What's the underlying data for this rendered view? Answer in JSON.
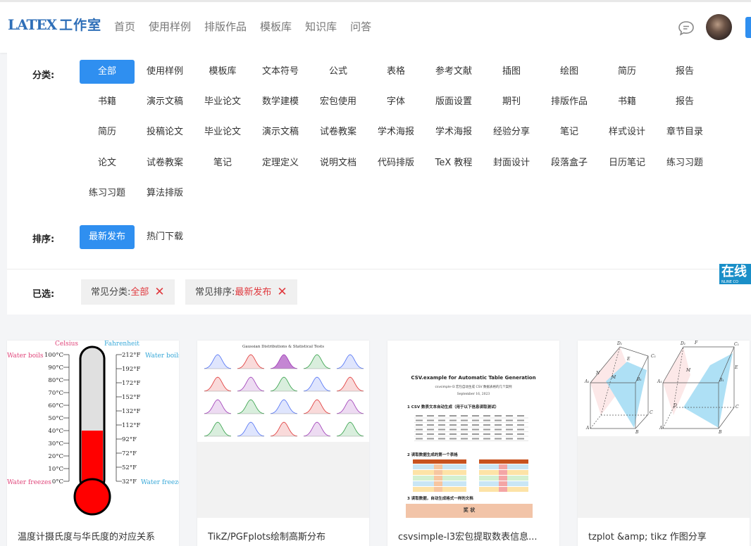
{
  "header": {
    "logo_latex": "LATEX",
    "logo_cn": "工作室",
    "nav": [
      "首页",
      "使用样例",
      "排版作品",
      "模板库",
      "知识库",
      "问答"
    ]
  },
  "filters": {
    "category_label": "分类:",
    "categories": [
      [
        "全部",
        "使用样例",
        "模板库",
        "文本符号",
        "公式",
        "表格",
        "参考文献",
        "插图",
        "绘图",
        "简历",
        "报告"
      ],
      [
        "书籍",
        "演示文稿",
        "毕业论文",
        "数学建模",
        "宏包使用",
        "字体",
        "版面设置",
        "期刊",
        "排版作品",
        "书籍",
        "报告"
      ],
      [
        "简历",
        "投稿论文",
        "毕业论文",
        "演示文稿",
        "试卷教案",
        "学术海报",
        "学术海报",
        "经验分享",
        "笔记",
        "样式设计",
        "章节目录"
      ],
      [
        "论文",
        "试卷教案",
        "笔记",
        "定理定义",
        "说明文档",
        "代码排版",
        "TeX 教程",
        "封面设计",
        "段落盒子",
        "日历笔记",
        "练习习题"
      ],
      [
        "练习习题",
        "算法排版"
      ]
    ],
    "active_category": "全部",
    "sort_label": "排序:",
    "sort_options": [
      "最新发布",
      "热门下载"
    ],
    "active_sort": "最新发布",
    "selected_label": "已选:",
    "selected": [
      {
        "key": "常见分类:",
        "value": "全部"
      },
      {
        "key": "常见排序:",
        "value": "最新发布"
      }
    ],
    "remove_icon": "close-icon",
    "accent_color": "#2f8ff0",
    "tag_value_color": "#e0393e"
  },
  "online_badge": {
    "text": "在线",
    "sub": "NLINE CO"
  },
  "cards": [
    {
      "title": "温度计摄氏度与华氏度的对应关系",
      "thumb": {
        "celsius": "Celsius",
        "fahrenheit": "Fahrenheit",
        "water_boils": "Water boils",
        "water_freezes": "Water freezes",
        "c_ticks": [
          "100°C",
          "90°C",
          "80°C",
          "70°C",
          "60°C",
          "50°C",
          "40°C",
          "30°C",
          "20°C",
          "10°C",
          "0°C"
        ],
        "f_ticks": [
          "212°F",
          "192°F",
          "172°F",
          "152°F",
          "132°F",
          "112°F",
          "92°F",
          "72°F",
          "52°F",
          "32°F"
        ],
        "mercury_level_c": 40
      }
    },
    {
      "title": "TikZ/PGFplots绘制高斯分布",
      "thumb": {
        "heading": "Gaussian Distributions & Statistical Tests"
      }
    },
    {
      "title": "csvsimple-l3宏包提取数表信息...",
      "thumb": {
        "heading": "CSV.example for Automatic Table Generation",
        "subheading": "csvsimple-l3 宏包自动生成 CSV 数据表格的几个案例",
        "date": "September 16, 2023",
        "sec1": "1  CSV 数表文本自动生成（用于以下信息读取测试）",
        "sec2": "2  读取数据生成的第一个表格",
        "sec3": "3  读取数据，自动生成格式一样的文档",
        "award": "奖  状"
      }
    },
    {
      "title": "tzplot &amp; tikz 作图分享",
      "thumb": {
        "vertices_left": [
          "A₁",
          "B₁",
          "C₁",
          "D₁",
          "A",
          "B",
          "C",
          "D",
          "M",
          "N",
          "E"
        ]
      }
    }
  ]
}
